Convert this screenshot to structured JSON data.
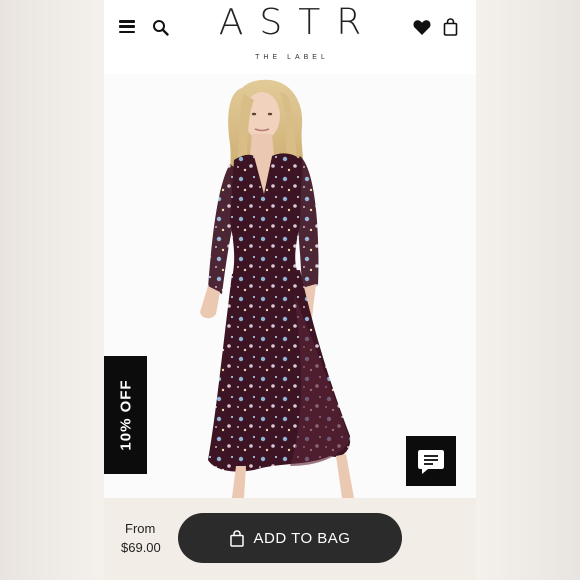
{
  "header": {
    "logo": "ASTR",
    "tagline": "THE LABEL",
    "icons": [
      "menu-icon",
      "search-icon",
      "heart-icon",
      "shopping-bag-icon"
    ]
  },
  "product": {
    "image_alt": "Model wearing long-sleeve burgundy floral wrap midi dress",
    "dress_color": "#3d1424",
    "floral_colors": [
      "#8fb3d4",
      "#d8c8d4",
      "#e6d9b0"
    ]
  },
  "promo": {
    "discount_label": "10% OFF"
  },
  "chat": {
    "icon": "chat-bubble-icon"
  },
  "purchase": {
    "from_label": "From",
    "price": "$69.00",
    "button_label": "ADD TO BAG"
  },
  "colors": {
    "button": "#2b2b2b",
    "promo_bg": "#0c0c0c",
    "footer_bg": "#f3ede7"
  }
}
